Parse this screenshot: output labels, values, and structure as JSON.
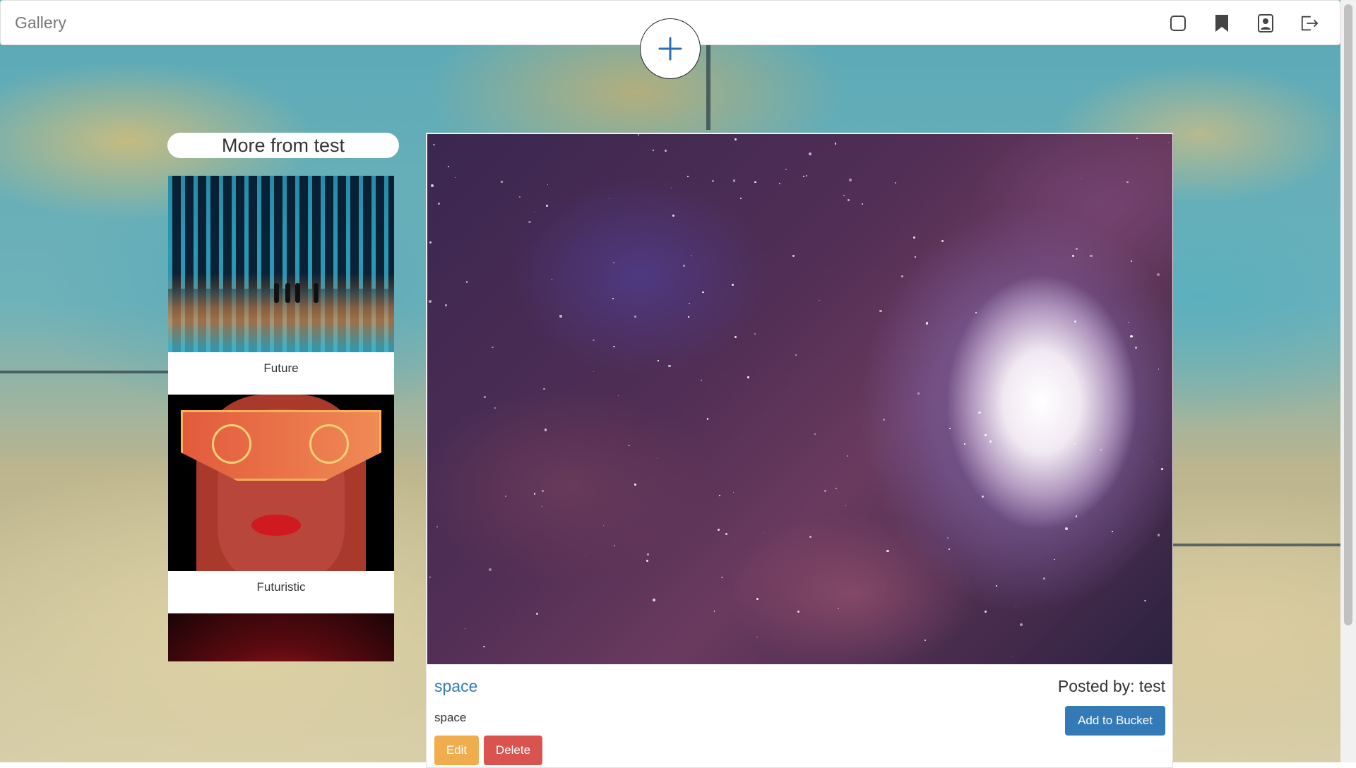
{
  "navbar": {
    "brand": "Gallery",
    "icons": [
      "square-icon",
      "bookmark-icon",
      "contact-icon",
      "logout-icon"
    ]
  },
  "add_button": {
    "icon": "plus-icon"
  },
  "sidebar": {
    "title": "More from test",
    "items": [
      {
        "caption": "Future"
      },
      {
        "caption": "Futuristic"
      },
      {
        "caption": ""
      }
    ]
  },
  "post": {
    "title": "space",
    "description": "space",
    "posted_by": "Posted by: test",
    "add_to_bucket_label": "Add to Bucket",
    "edit_label": "Edit",
    "delete_label": "Delete"
  },
  "colors": {
    "primary": "#337ab7",
    "warning": "#f0ad4e",
    "danger": "#d9534f"
  }
}
